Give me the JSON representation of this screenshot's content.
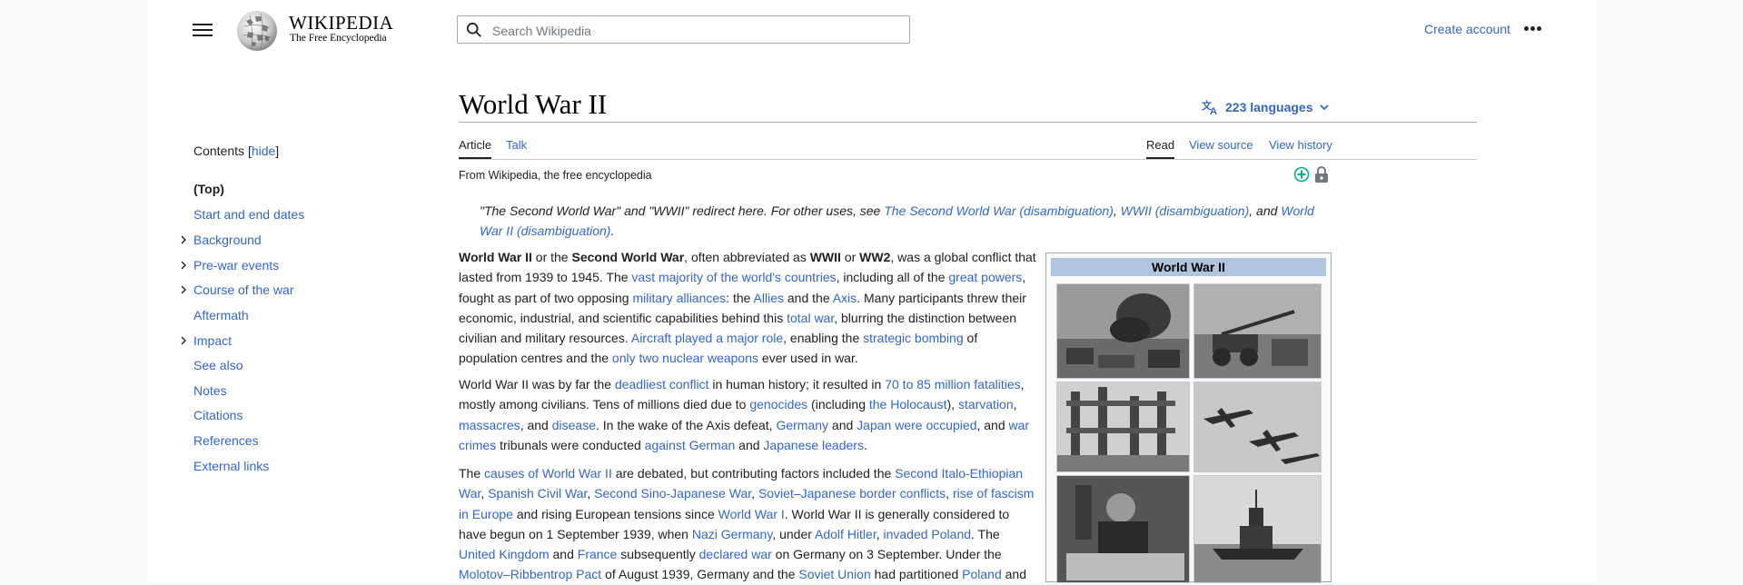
{
  "header": {
    "wordmark": "Wikipedia",
    "tagline": "The Free Encyclopedia",
    "search_placeholder": "Search Wikipedia",
    "create_account": "Create account",
    "menu_icon": "hamburger-icon",
    "more_icon": "ellipsis-icon"
  },
  "toc": {
    "title": "Contents",
    "hide_label": "hide",
    "items": [
      {
        "label": "(Top)",
        "expandable": false
      },
      {
        "label": "Start and end dates",
        "expandable": false
      },
      {
        "label": "Background",
        "expandable": true
      },
      {
        "label": "Pre-war events",
        "expandable": true
      },
      {
        "label": "Course of the war",
        "expandable": true
      },
      {
        "label": "Aftermath",
        "expandable": false
      },
      {
        "label": "Impact",
        "expandable": true
      },
      {
        "label": "See also",
        "expandable": false
      },
      {
        "label": "Notes",
        "expandable": false
      },
      {
        "label": "Citations",
        "expandable": false
      },
      {
        "label": "References",
        "expandable": false
      },
      {
        "label": "External links",
        "expandable": false
      }
    ]
  },
  "article": {
    "title": "World War II",
    "languages": "223 languages",
    "tabs_left": [
      "Article",
      "Talk"
    ],
    "tabs_right": [
      "Read",
      "View source",
      "View history"
    ],
    "from": "From Wikipedia, the free encyclopedia",
    "hatnote": {
      "p1": "\"The Second World War\" and \"WWII\" redirect here. For other uses, see ",
      "l1": "The Second World War (disambiguation)",
      "s1": ", ",
      "l2": "WWII (disambiguation)",
      "s2": ", and ",
      "l3": "World War II (disambiguation)",
      "s3": "."
    },
    "p1": {
      "b1": "World War II",
      "t1": " or the ",
      "b2": "Second World War",
      "t2": ", often abbreviated as ",
      "b3": "WWII",
      "t3": " or ",
      "b4": "WW2",
      "t4": ", was a global conflict that lasted from 1939 to 1945. The ",
      "l1": "vast majority of the world's countries",
      "t5": ", including all of the ",
      "l2": "great powers",
      "t6": ", fought as part of two opposing ",
      "l3": "military alliances",
      "t7": ": the ",
      "l4": "Allies",
      "t8": " and the ",
      "l5": "Axis",
      "t9": ". Many participants threw their economic, industrial, and scientific capabilities behind this ",
      "l6": "total war",
      "t10": ", blurring the distinction between civilian and military resources. ",
      "l7": "Aircraft played a major role",
      "t11": ", enabling the ",
      "l8": "strategic bombing",
      "t12": " of population centres and the ",
      "l9": "only two nuclear weapons",
      "t13": " ever used in war."
    },
    "p2": {
      "t1": "World War II was by far the ",
      "l1": "deadliest conflict",
      "t2": " in human history; it resulted in ",
      "l2": "70 to 85 million fatalities",
      "t3": ", mostly among civilians. Tens of millions died due to ",
      "l3": "genocides",
      "t4": " (including ",
      "l4": "the Holocaust",
      "t5": "), ",
      "l5": "starvation",
      "t6": ", ",
      "l6": "massacres",
      "t7": ", and ",
      "l7": "disease",
      "t8": ". In the wake of the Axis defeat, ",
      "l8": "Germany",
      "t9": " and ",
      "l9": "Japan were occupied",
      "t10": ", and ",
      "l10": "war crimes",
      "t11": " tribunals were conducted ",
      "l11": "against German",
      "t12": " and ",
      "l12": "Japanese leaders",
      "t13": "."
    },
    "p3": {
      "t1": "The ",
      "l1": "causes of World War II",
      "t2": " are debated, but contributing factors included the ",
      "l2": "Second Italo-Ethiopian War",
      "t3": ", ",
      "l3": "Spanish Civil War",
      "t4": ", ",
      "l4": "Second Sino-Japanese War",
      "t5": ", ",
      "l5": "Soviet–Japanese border conflicts",
      "t6": ", ",
      "l6": "rise of fascism in Europe",
      "t7": " and rising European tensions since ",
      "l7": "World War I",
      "t8": ". World War II is generally considered to have begun on 1 September 1939, when ",
      "l8": "Nazi Germany",
      "t9": ", under ",
      "l9": "Adolf Hitler",
      "t10": ", ",
      "l10": "invaded Poland",
      "t11": ". The ",
      "l11": "United Kingdom",
      "t12": " and ",
      "l12": "France",
      "t13": " subsequently ",
      "l13": "declared war",
      "t14": " on Germany on 3 September. Under the ",
      "l14": "Molotov–Ribbentrop Pact",
      "t15": " of August 1939, Germany and the ",
      "l15": "Soviet Union",
      "t16": " had partitioned ",
      "l16": "Poland",
      "t17": " and"
    }
  },
  "infobox": {
    "title": "World War II"
  }
}
